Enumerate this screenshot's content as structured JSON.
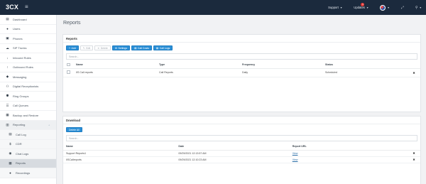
{
  "app": {
    "logo_text": "3CX"
  },
  "topbar": {
    "support_label": "Support",
    "updates_label": "Updates",
    "updates_count": "3"
  },
  "sidebar": {
    "items": [
      {
        "label": "Dashboard",
        "icon": "dashboard-icon"
      },
      {
        "label": "Users",
        "icon": "user-icon"
      },
      {
        "label": "Phones",
        "icon": "phone-icon"
      },
      {
        "label": "SIP Trunks",
        "icon": "sip-trunk-icon"
      },
      {
        "label": "Inbound Rules",
        "icon": "inbound-arrow-icon"
      },
      {
        "label": "Outbound Rules",
        "icon": "outbound-arrow-icon"
      },
      {
        "label": "Messaging",
        "icon": "chat-icon"
      },
      {
        "label": "Digital Receptionists",
        "icon": "receptionist-icon"
      },
      {
        "label": "Ring Groups",
        "icon": "ring-group-icon"
      },
      {
        "label": "Call Queues",
        "icon": "queue-icon"
      },
      {
        "label": "Backup and Restore",
        "icon": "backup-icon"
      },
      {
        "label": "Reporting",
        "icon": "reporting-icon",
        "expanded": true
      },
      {
        "label": "Call Log",
        "icon": "call-log-icon",
        "sub": true
      },
      {
        "label": "CDR",
        "icon": "dollar-icon",
        "sub": true
      },
      {
        "label": "Chat Logs",
        "icon": "chat-log-icon",
        "sub": true
      },
      {
        "label": "Reports",
        "icon": "reports-icon",
        "sub": true,
        "active": true
      },
      {
        "label": "Recordings",
        "icon": "recordings-icon",
        "sub": true
      }
    ]
  },
  "page": {
    "title": "Reports"
  },
  "reports_panel": {
    "title": "Reports",
    "buttons": {
      "add": "Add",
      "edit": "Edit",
      "delete": "Delete",
      "settings": "Settings",
      "call_cost": "Call Costs",
      "call_logs": "Call Logs"
    },
    "search_placeholder": "Search...",
    "columns": [
      "Name",
      "Type",
      "Frequency",
      "Status"
    ],
    "rows": [
      {
        "name": "IIS Call reports",
        "type": "Call Reports",
        "frequency": "Daily",
        "status": "Scheduled"
      }
    ]
  },
  "download_panel": {
    "title": "Download",
    "delete_all_label": "Delete All",
    "search_placeholder": "Search...",
    "columns": [
      "Name",
      "Date",
      "Report URL"
    ],
    "rows": [
      {
        "name": "Support Reports1",
        "date": "09/29/2021 12:13:57 AM",
        "url": "View"
      },
      {
        "name": "IISCallreports",
        "date": "09/29/2021 12:10:23 AM",
        "url": "View"
      }
    ]
  },
  "colors": {
    "topbar": "#1b2a3d",
    "primary_button": "#2b8fd6",
    "page_bg": "#f1f2f4"
  }
}
